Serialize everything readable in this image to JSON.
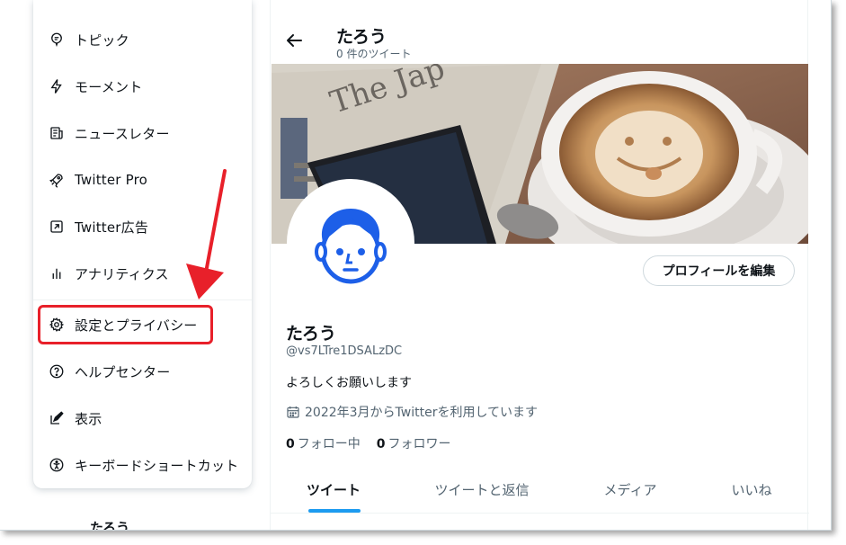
{
  "menu": {
    "items": [
      {
        "label": "トピック",
        "icon": "topic-icon"
      },
      {
        "label": "モーメント",
        "icon": "lightning-icon"
      },
      {
        "label": "ニュースレター",
        "icon": "newsletter-icon"
      },
      {
        "label": "Twitter Pro",
        "icon": "rocket-icon"
      },
      {
        "label": "Twitter広告",
        "icon": "external-link-icon"
      },
      {
        "label": "アナリティクス",
        "icon": "analytics-icon"
      },
      {
        "label": "設定とプライバシー",
        "icon": "gear-icon"
      },
      {
        "label": "ヘルプセンター",
        "icon": "help-icon"
      },
      {
        "label": "表示",
        "icon": "display-icon"
      },
      {
        "label": "キーボードショートカット",
        "icon": "accessibility-icon"
      }
    ]
  },
  "peek": {
    "name": "たろう"
  },
  "header": {
    "name": "たろう",
    "tweet_count": "0 件のツイート"
  },
  "profile": {
    "edit_label": "プロフィールを編集",
    "name": "たろう",
    "handle": "@vs7LTre1DSALzDC",
    "bio": "よろしくお願いします",
    "joined": "2022年3月からTwitterを利用しています",
    "following_count": "0",
    "following_label": "フォロー中",
    "followers_count": "0",
    "followers_label": "フォロワー"
  },
  "tabs": [
    {
      "label": "ツイート",
      "active": true
    },
    {
      "label": "ツイートと返信",
      "active": false
    },
    {
      "label": "メディア",
      "active": false
    },
    {
      "label": "いいね",
      "active": false
    }
  ],
  "colors": {
    "accent": "#1d9bf0",
    "highlight": "#e8202a",
    "avatar_blue": "#1d5fe8"
  }
}
